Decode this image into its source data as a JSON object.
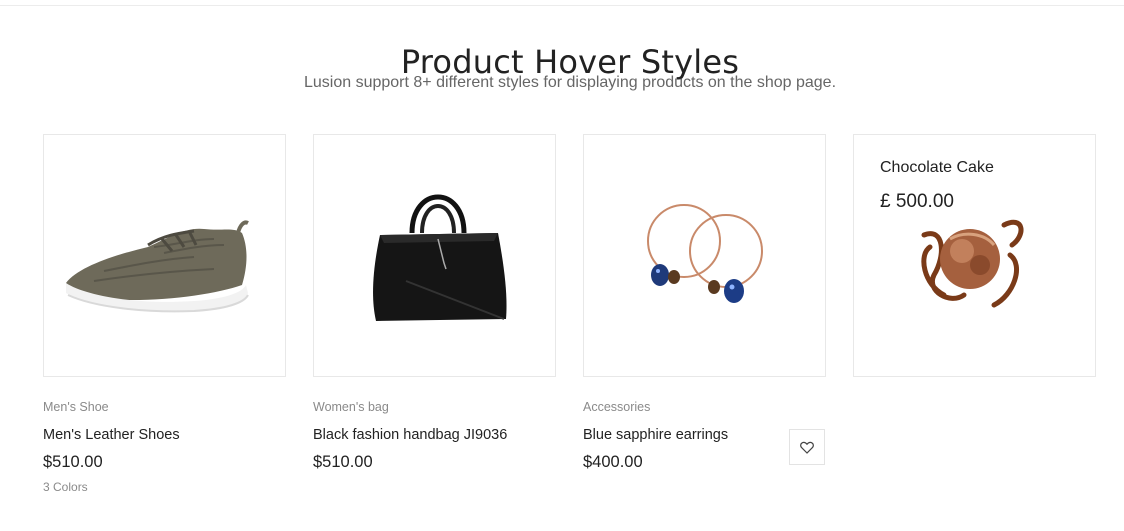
{
  "section": {
    "title": "Product Hover Styles",
    "subtitle": "Lusion support 8+ different styles for displaying products on the shop page."
  },
  "products": [
    {
      "category": "Men's Shoe",
      "name": "Men's Leather Shoes",
      "price": "$510.00",
      "colors": "3 Colors",
      "image_icon": "sneaker-image"
    },
    {
      "category": "Women's bag",
      "name": "Black fashion handbag JI9036",
      "price": "$510.00",
      "image_icon": "handbag-image"
    },
    {
      "category": "Accessories",
      "name": "Blue sapphire earrings",
      "price": "$400.00",
      "image_icon": "earrings-image",
      "wishlist_icon": "heart-icon"
    },
    {
      "name": "Chocolate Cake",
      "price": "£ 500.00",
      "image_icon": "chocolate-cake-image"
    }
  ],
  "colors": {
    "text": "#222222",
    "muted": "#8a8a8a",
    "border": "#e8e8e8"
  }
}
